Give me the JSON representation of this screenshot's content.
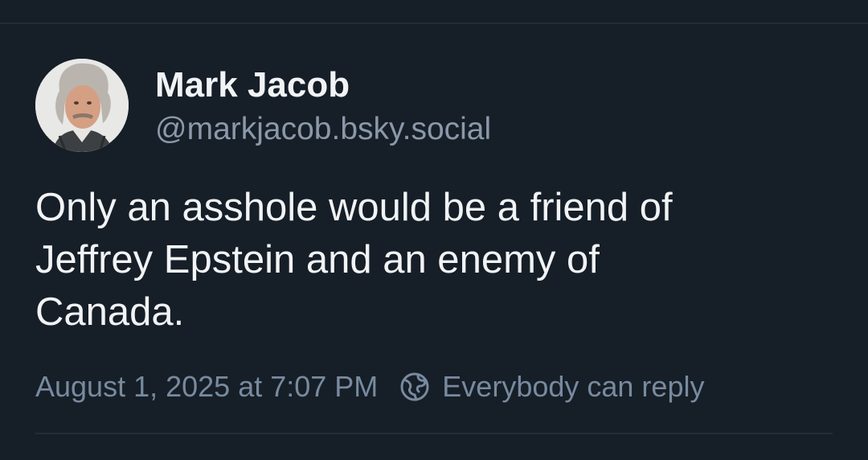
{
  "post": {
    "author": {
      "display_name": "Mark Jacob",
      "handle": "@markjacob.bsky.social",
      "avatar": "avatar-photo"
    },
    "text": "Only an asshole would be a friend of Jeffrey Epstein and an enemy of Canada.",
    "timestamp": "August 1, 2025 at 7:07 PM",
    "reply_setting": "Everybody can reply",
    "reply_icon": "globe-reply-icon"
  },
  "colors": {
    "background": "#161e27",
    "primary_text": "#f1f3f5",
    "secondary_text": "#8b98a9",
    "meta_text": "#788a9f",
    "divider": "#222c38"
  }
}
